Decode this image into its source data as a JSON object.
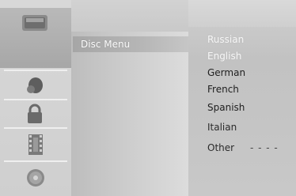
{
  "menu": {
    "selected_item": "Disc Menu"
  },
  "languages": {
    "items": [
      "Russian",
      "English",
      "German",
      "French",
      "Spanish",
      "Italian",
      "Other"
    ],
    "other_value": "- - - -"
  },
  "icons": [
    "disc-setup-icon",
    "language-icon",
    "lock-icon",
    "film-icon",
    "disc-icon"
  ]
}
